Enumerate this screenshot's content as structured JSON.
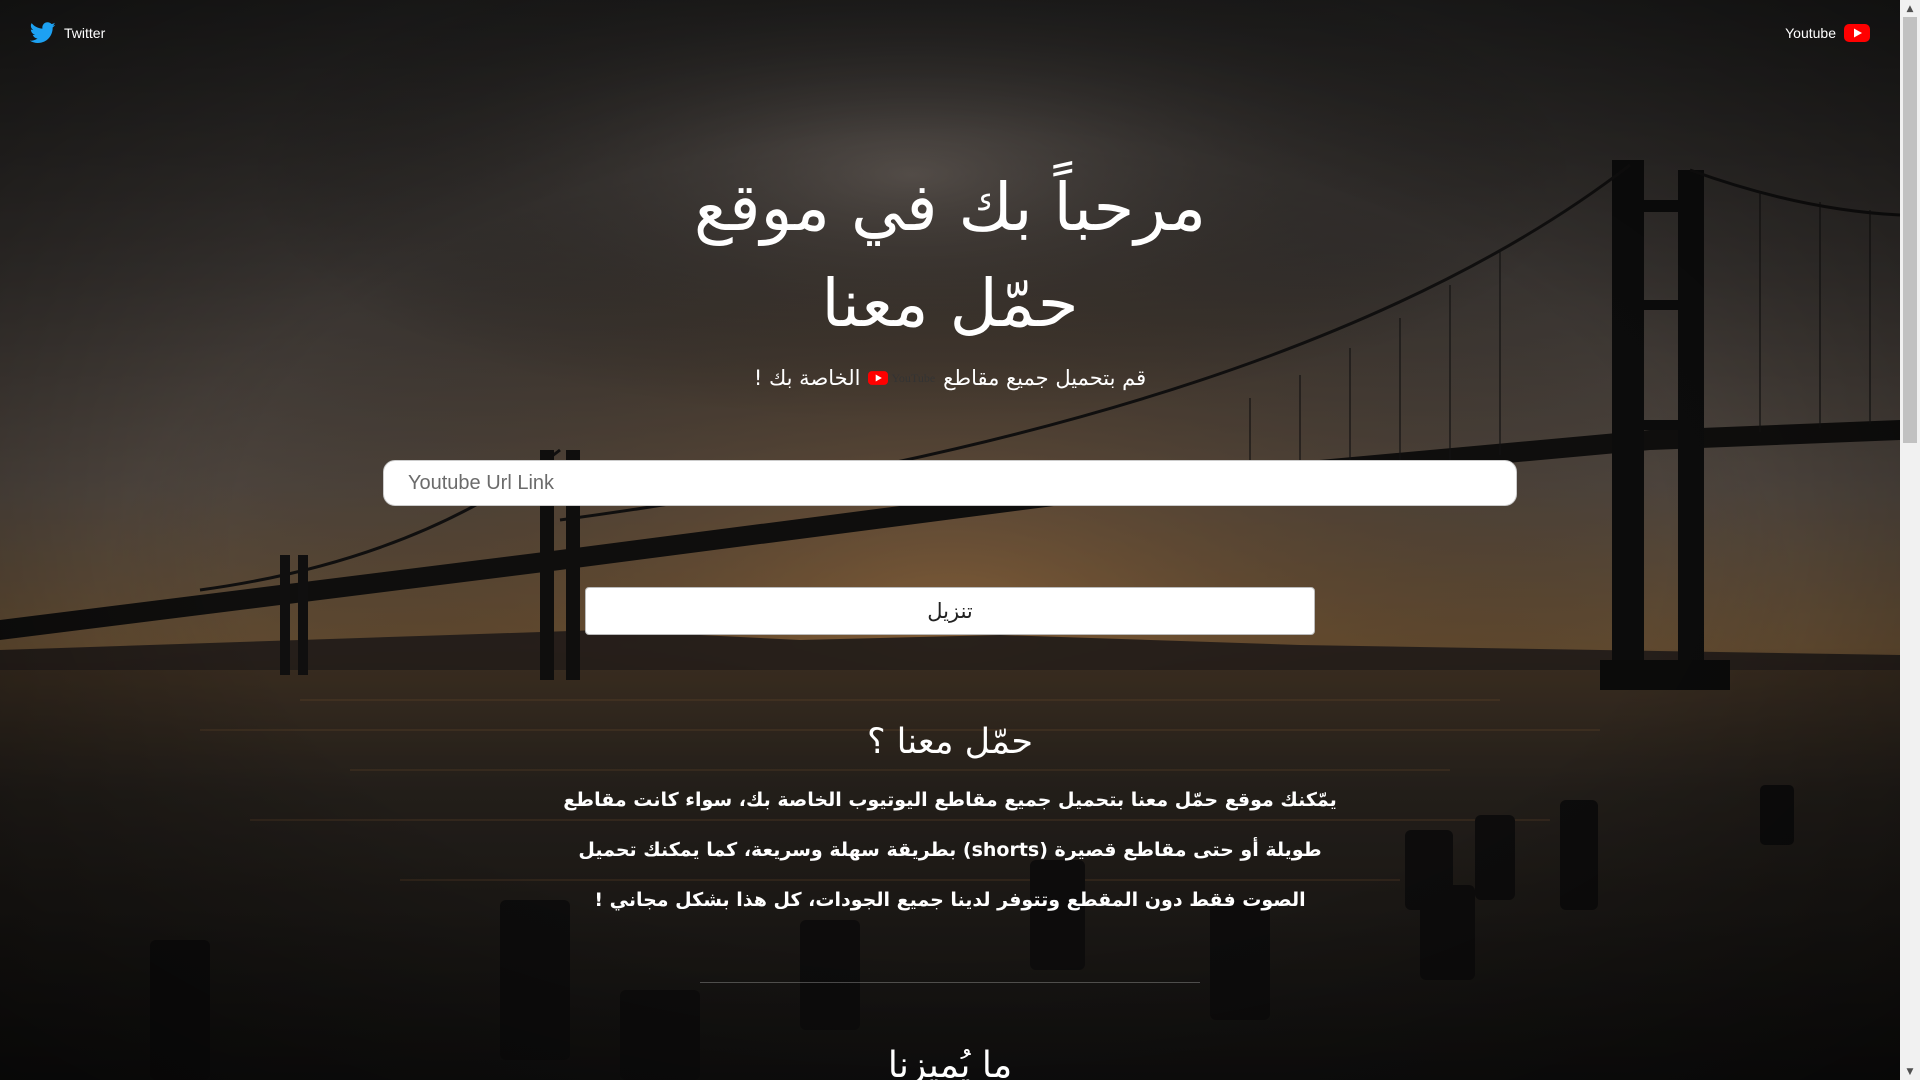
{
  "header": {
    "twitter_label": "Twitter",
    "twitter_icon": "twitter-bird-icon",
    "youtube_label": "Youtube",
    "youtube_icon": "youtube-play-icon"
  },
  "hero": {
    "title_line1": "مرحباً بك في موقع",
    "title_line2": "حمّل معنا",
    "subtitle_before": "قم بتحميل جميع مقاطع",
    "subtitle_logo_text": "YouTube",
    "subtitle_after": "الخاصة بك !"
  },
  "search": {
    "placeholder": "Youtube Url Link",
    "value": ""
  },
  "download_button_label": "تنزيل",
  "about": {
    "title": "حمّل معنا ؟",
    "text": "يمّكنك موقع حمّل معنا بتحميل جميع مقاطع اليوتيوب الخاصة بك، سواء كانت مقاطع طويلة أو حتى مقاطع قصيرة (shorts) بطريقة سهلة وسريعة، كما يمكنك تحميل الصوت فقط دون المقطع وتتوفر لدينا جميع الجودات، كل هذا بشكل مجاني !"
  },
  "features": {
    "title": "ما يُميزنا"
  },
  "colors": {
    "twitter": "#1da1f2",
    "youtube": "#ff0000",
    "text": "#ffffff"
  }
}
